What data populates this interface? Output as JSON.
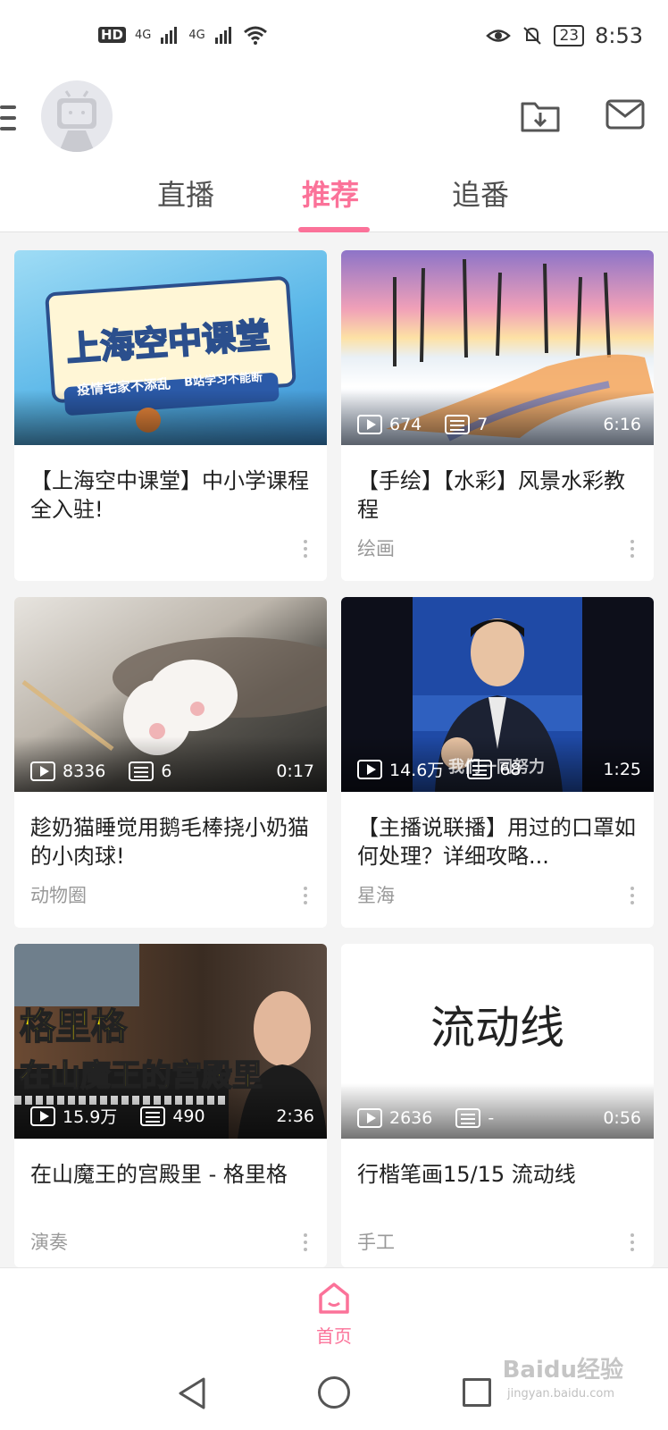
{
  "status_bar": {
    "left_indicators": [
      "HD",
      "4G",
      "4G"
    ],
    "battery": "23",
    "time": "8:53"
  },
  "header": {
    "tabs": [
      {
        "label": "直播",
        "active": false
      },
      {
        "label": "推荐",
        "active": true
      },
      {
        "label": "追番",
        "active": false
      }
    ]
  },
  "feed": {
    "cards": [
      {
        "thumb_headline": "上海空中课堂",
        "thumb_sub_left": "疫情宅家不添乱",
        "thumb_sub_right": "B站学习不能断",
        "title": "【上海空中课堂】中小学课程全入驻!",
        "plays": "",
        "danmaku": "",
        "duration": "",
        "category": ""
      },
      {
        "title": "【手绘】【水彩】风景水彩教程",
        "plays": "674",
        "danmaku": "7",
        "duration": "6:16",
        "category": "绘画"
      },
      {
        "title": "趁奶猫睡觉用鹅毛棒挠小奶猫的小肉球!",
        "plays": "8336",
        "danmaku": "6",
        "duration": "0:17",
        "category": "动物圈"
      },
      {
        "title": "【主播说联播】用过的口罩如何处理？详细攻略...",
        "plays": "14.6万",
        "danmaku": "68",
        "duration": "1:25",
        "category": "星海",
        "thumb_caption": "我们一同努力"
      },
      {
        "thumb_line1": "格里格",
        "thumb_line2": "在山魔王的宫殿里",
        "title": "在山魔王的宫殿里 - 格里格",
        "plays": "15.9万",
        "danmaku": "490",
        "duration": "2:36",
        "category": "演奏"
      },
      {
        "thumb_text": "流动线",
        "title": "行楷笔画15/15 流动线",
        "plays": "2636",
        "danmaku": "-",
        "duration": "0:56",
        "category": "手工"
      }
    ]
  },
  "bottom_nav": {
    "home_label": "首页"
  },
  "watermark": {
    "brand": "Baidu经验",
    "url": "jingyan.baidu.com"
  },
  "colors": {
    "accent": "#fb7299",
    "background": "#f4f4f4"
  }
}
